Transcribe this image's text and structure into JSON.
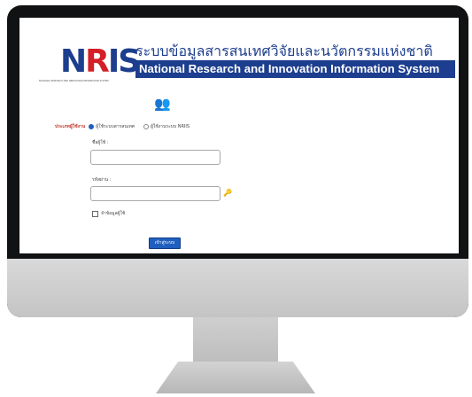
{
  "header": {
    "logo_text_n": "N",
    "logo_text_r": "R",
    "logo_text_is": "IS",
    "logo_tagline": "NATIONAL RESEARCH AND INNOVATION INFORMATION SYSTEM",
    "title_th": "ระบบข้อมูลสารสนเทศวิจัยและนวัตกรรมแห่งชาติ",
    "title_en": "National Research and Innovation Information System"
  },
  "login": {
    "user_icon": "user-icon",
    "type_label": "ประเภทผู้ใช้งาน",
    "options": [
      {
        "label": "ผู้ใช้ระบบสารสนเทศ",
        "selected": true
      },
      {
        "label": "ผู้ใช้งานระบบ NRIIS",
        "selected": false
      }
    ],
    "username_label": "ชื่อผู้ใช้ :",
    "username_value": "",
    "password_label": "รหัสผ่าน :",
    "password_value": "",
    "remember_label": "จำข้อมูลผู้ใช้",
    "login_button": "เข้าสู่ระบบ"
  },
  "colors": {
    "brand_blue": "#1d3e8e",
    "brand_red": "#d41f26",
    "button_blue": "#1f5fbf"
  }
}
